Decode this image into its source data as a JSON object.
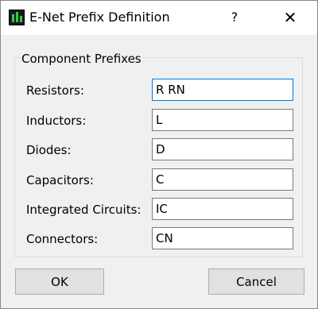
{
  "window": {
    "title": "E-Net Prefix Definition",
    "help_label": "?",
    "close_label": "✕"
  },
  "group": {
    "title": "Component Prefixes"
  },
  "fields": [
    {
      "label": "Resistors:",
      "value": "R RN"
    },
    {
      "label": "Inductors:",
      "value": "L"
    },
    {
      "label": "Diodes:",
      "value": "D"
    },
    {
      "label": "Capacitors:",
      "value": "C"
    },
    {
      "label": "Integrated Circuits:",
      "value": "IC"
    },
    {
      "label": "Connectors:",
      "value": "CN"
    }
  ],
  "buttons": {
    "ok_label": "OK",
    "cancel_label": "Cancel"
  },
  "colors": {
    "focus_border": "#0078d7",
    "icon_bar": "#2ecc40"
  }
}
